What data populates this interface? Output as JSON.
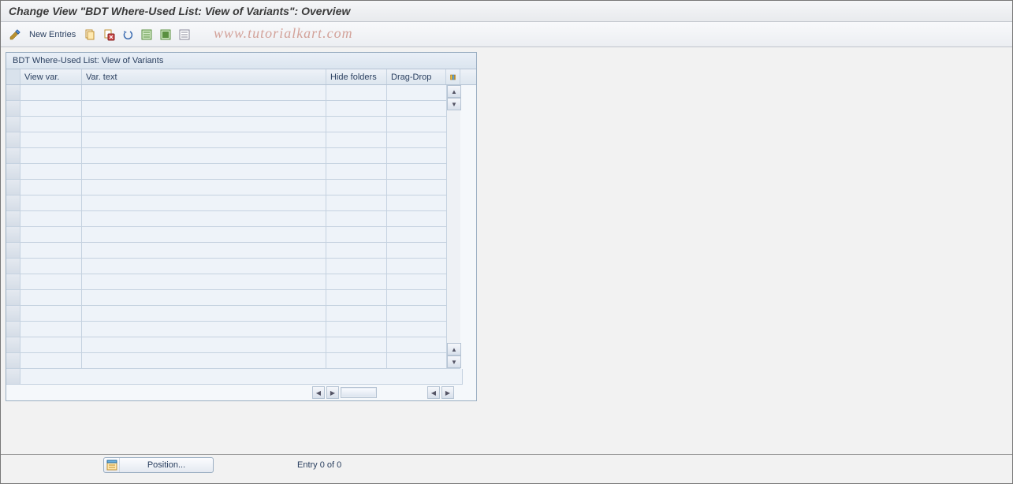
{
  "title": "Change View \"BDT Where-Used List: View of Variants\": Overview",
  "toolbar": {
    "new_entries": "New Entries"
  },
  "panel": {
    "title": "BDT Where-Used List: View of Variants"
  },
  "columns": {
    "view_var": "View var.",
    "var_text": "Var. text",
    "hide_folders": "Hide folders",
    "drag_drop": "Drag-Drop"
  },
  "rows_count": 18,
  "position_button": "Position...",
  "entry_display": "Entry 0 of 0",
  "watermark": "www.tutorialkart.com"
}
